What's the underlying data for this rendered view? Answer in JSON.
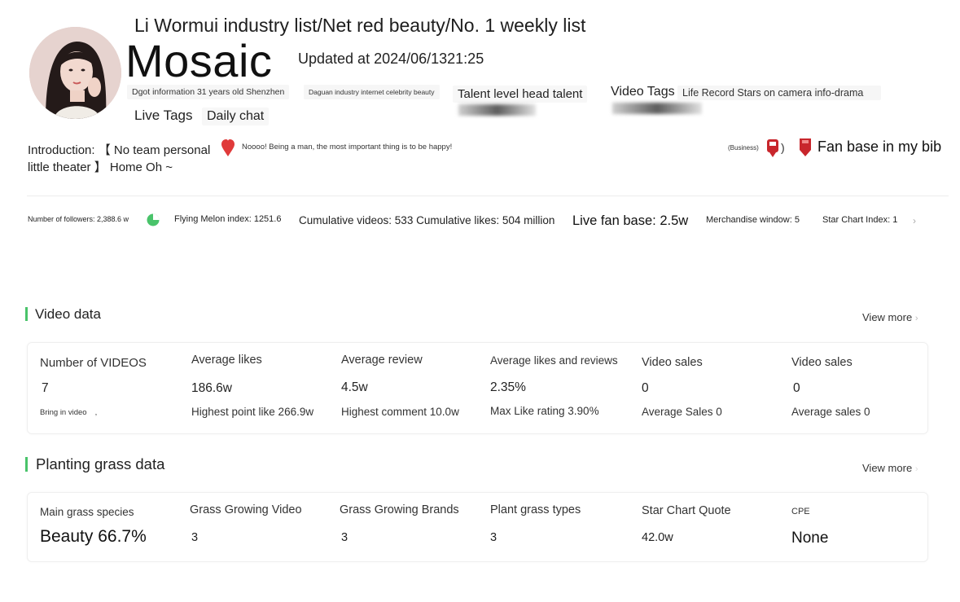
{
  "profile": {
    "rank_line": "Li Wormui industry list/Net red beauty/No. 1 weekly list",
    "name": "Mosaic",
    "updated": "Updated at 2024/06/1321:25",
    "tags": {
      "dgot": "Dgot information 31 years old Shenzhen",
      "daguan": "Daguan industry internet celebrity beauty",
      "talent": "Talent level head talent",
      "video_tags_label": "Video Tags",
      "video_tags_value": "Life Record Stars on camera info-drama",
      "live_tags_label": "Live Tags",
      "live_tags_value": "Daily chat"
    },
    "intro": "Introduction: 【 No team personal little theater 】 Home Oh ~",
    "note": "Noooo! Being a man, the most important thing is to be happy!",
    "business": "(Business)",
    "business_paren": ")",
    "fan_base": "Fan base in my bib"
  },
  "stats": {
    "followers": "Number of followers: 2,388.6 w",
    "melon": "Flying Melon index: 1251.6",
    "cumulative": "Cumulative videos: 533 Cumulative likes: 504 million",
    "live_fan": "Live fan base: 2.5w",
    "merch": "Merchandise window: 5",
    "star_index": "Star Chart Index: 1"
  },
  "video_section": {
    "title": "Video data",
    "view_more": "View more",
    "columns": [
      {
        "label": "Number of VIDEOS",
        "value": "7",
        "sub": "Bring in video",
        "sub_extra": ","
      },
      {
        "label": "Average likes",
        "value": "186.6w",
        "sub": "Highest point like 266.9w"
      },
      {
        "label": "Average review",
        "value": "4.5w",
        "sub": "Highest comment 10.0w"
      },
      {
        "label": "Average likes and reviews",
        "value": "2.35%",
        "sub": "Max Like rating 3.90%"
      },
      {
        "label": "Video sales",
        "value": "0",
        "sub": "Average Sales 0"
      },
      {
        "label": "Video sales",
        "value": "0",
        "sub": "Average sales 0"
      }
    ]
  },
  "grass_section": {
    "title": "Planting grass data",
    "view_more": "View more",
    "columns": [
      {
        "label": "Main grass species",
        "value": "Beauty 66.7%"
      },
      {
        "label": "Grass Growing Video",
        "value": "3"
      },
      {
        "label": "Grass Growing Brands",
        "value": "3"
      },
      {
        "label": "Plant grass types",
        "value": "3"
      },
      {
        "label": "Star Chart Quote",
        "value": "42.0w"
      },
      {
        "label": "CPE",
        "value": "None"
      }
    ]
  },
  "colors": {
    "accent_green": "#49c36a",
    "heart_red": "#e03a3a",
    "icon_red": "#c8262c"
  },
  "icons": [
    "red-heart-icon",
    "red-badge-icon",
    "red-ribbon-icon",
    "green-pie-icon",
    "chevron-right-icon"
  ]
}
